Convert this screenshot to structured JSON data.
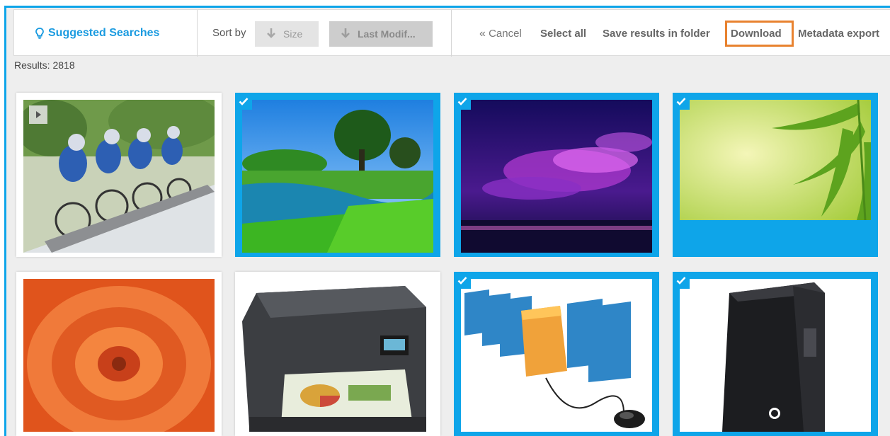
{
  "toolbar": {
    "suggested_label": "Suggested Searches",
    "sort_label": "Sort by",
    "sort_size_label": "Size",
    "sort_modified_label": "Last Modif...",
    "cancel_label": "Cancel",
    "select_all_label": "Select all",
    "save_results_label": "Save results in folder",
    "download_label": "Download",
    "metadata_export_label": "Metadata export"
  },
  "results": {
    "text": "Results: 2818"
  },
  "colors": {
    "accent": "#0ea5e9",
    "link": "#1b9be0",
    "highlight": "#e8822f"
  },
  "tiles": [
    {
      "subject": "bmx-riders",
      "selected": false,
      "has_play": true
    },
    {
      "subject": "green-landscape",
      "selected": true
    },
    {
      "subject": "purple-sky",
      "selected": true
    },
    {
      "subject": "green-leaves",
      "selected": true
    },
    {
      "subject": "orange-flower",
      "selected": false
    },
    {
      "subject": "printer",
      "selected": false
    },
    {
      "subject": "folders-mouse",
      "selected": true
    },
    {
      "subject": "pc-tower",
      "selected": true
    }
  ]
}
